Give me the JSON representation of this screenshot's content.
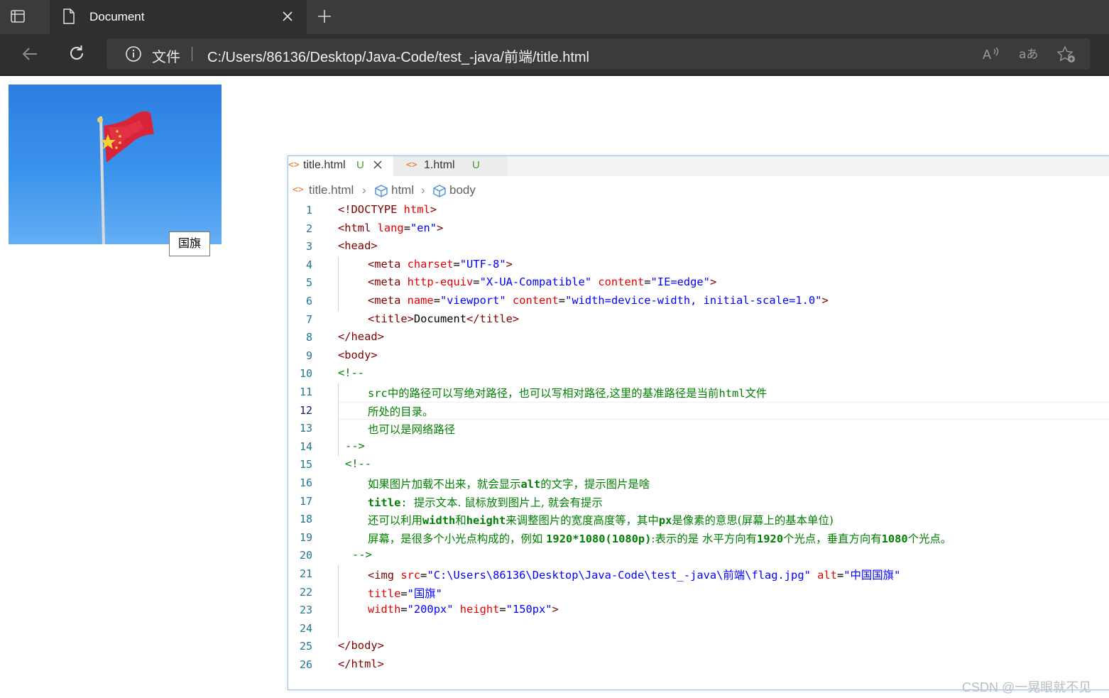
{
  "browser": {
    "tab_title": "Document",
    "address_scheme": "文件",
    "address_url": "C:/Users/86136/Desktop/Java-Code/test_-java/前端/title.html",
    "icons": {
      "tab_actions": "tab-actions-icon",
      "document": "document-icon",
      "close": "close-icon",
      "new_tab": "plus-icon",
      "back": "back-arrow-icon",
      "reload": "reload-icon",
      "info": "info-icon",
      "read_aloud": "read-aloud-icon",
      "translate": "translate-icon",
      "favorite": "add-favorite-icon"
    },
    "colors": {
      "chrome": "#3b3b3d",
      "tab_active": "#2f2f31",
      "text": "#ffffff"
    }
  },
  "page": {
    "image_tooltip": "国旗"
  },
  "editor": {
    "tabs": [
      {
        "label": "title.html",
        "status": "U"
      },
      {
        "label": "1.html",
        "status": "U"
      }
    ],
    "breadcrumb": {
      "file": "title.html",
      "node1": "html",
      "node2": "body"
    },
    "current_line": 12,
    "lines": [
      "1",
      "2",
      "3",
      "4",
      "5",
      "6",
      "7",
      "8",
      "9",
      "10",
      "11",
      "12",
      "13",
      "14",
      "15",
      "16",
      "17",
      "18",
      "19",
      "20",
      "21",
      "22",
      "23",
      "24",
      "25",
      "26"
    ],
    "code": {
      "l1": {
        "a": "<!DOCTYPE ",
        "b": "html",
        "c": ">"
      },
      "l2": {
        "a": "<html ",
        "b": "lang",
        "c": "=",
        "d": "\"en\"",
        "e": ">"
      },
      "l3": {
        "a": "<head>"
      },
      "l4": {
        "a": "<meta ",
        "b": "charset",
        "c": "=",
        "d": "\"UTF-8\"",
        "e": ">"
      },
      "l5": {
        "a": "<meta ",
        "b": "http-equiv",
        "c": "=",
        "d": "\"X-UA-Compatible\"",
        "e": " ",
        "f": "content",
        "g": "=",
        "h": "\"IE=edge\"",
        "i": ">"
      },
      "l6": {
        "a": "<meta ",
        "b": "name",
        "c": "=",
        "d": "\"viewport\"",
        "e": " ",
        "f": "content",
        "g": "=",
        "h": "\"width=device-width, initial-scale=1.0\"",
        "i": ">"
      },
      "l7": {
        "a": "<title>",
        "b": "Document",
        "c": "</title>"
      },
      "l8": {
        "a": "</head>"
      },
      "l9": {
        "a": "<body>"
      },
      "l10": {
        "a": "<!--"
      },
      "l11": {
        "a": "src",
        "b": "中的路径可以写绝对路径，也可以写相对路径,这里的基准路径是当前",
        "c": "html",
        "d": "文件"
      },
      "l12": {
        "a": "所处的目录。"
      },
      "l13": {
        "a": "也可以是网络路径"
      },
      "l14": {
        "a": "-->"
      },
      "l15": {
        "a": "<!--"
      },
      "l16": {
        "a": "如果图片加载不出来，就会显示",
        "b": "alt",
        "c": "的文字，提示图片是啥"
      },
      "l17": {
        "a": "title",
        "b": ": ",
        "c": "提示文本. 鼠标放到图片上, 就会有提示"
      },
      "l18": {
        "a": "还可以利用",
        "b": "width",
        "c": "和",
        "d": "height",
        "e": "来调整图片的宽度高度等，其中",
        "f": "px",
        "g": "是像素的意思(屏幕上的基本单位)"
      },
      "l19": {
        "a": "屏幕，是很多个小光点构成的，例如 ",
        "b": "1920*1080(1080p)",
        "c": ":表示的是 水平方向有",
        "d": "1920",
        "e": "个光点，垂直方向有",
        "f": "1080",
        "g": "个光点。"
      },
      "l20": {
        "a": "-->"
      },
      "l21": {
        "a": "<img ",
        "b": "src",
        "c": "=",
        "d": "\"C:\\Users\\86136\\Desktop\\Java-Code\\test_-java\\前端\\flag.jpg\"",
        "e": " ",
        "f": "alt",
        "g": "=",
        "h": "\"中国国旗\""
      },
      "l22": {
        "a": "title",
        "b": "=",
        "c": "\"国旗\""
      },
      "l23": {
        "a": "width",
        "b": "=",
        "c": "\"200px\"",
        "d": " ",
        "e": "height",
        "f": "=",
        "g": "\"150px\"",
        "h": ">"
      },
      "l24": {},
      "l25": {
        "a": "</body>"
      },
      "l26": {
        "a": "</html>"
      }
    }
  },
  "watermark": "CSDN @一晃眼就不见"
}
